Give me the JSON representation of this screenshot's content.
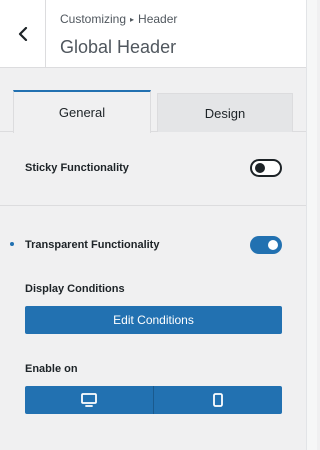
{
  "header": {
    "breadcrumb_parent": "Customizing",
    "breadcrumb_separator": "▸",
    "breadcrumb_current": "Header",
    "title": "Global Header"
  },
  "tabs": [
    {
      "label": "General",
      "active": true
    },
    {
      "label": "Design",
      "active": false
    }
  ],
  "settings": {
    "sticky": {
      "label": "Sticky Functionality",
      "enabled": false
    },
    "transparent": {
      "label": "Transparent Functionality",
      "enabled": true
    },
    "display_conditions": {
      "label": "Display Conditions",
      "button_label": "Edit Conditions"
    },
    "enable_on": {
      "label": "Enable on",
      "devices": [
        {
          "icon": "desktop-icon"
        },
        {
          "icon": "mobile-icon"
        }
      ]
    }
  },
  "colors": {
    "accent": "#2271b1",
    "panel_bg": "#f0f0f1",
    "header_bg": "#ffffff",
    "text": "#1d2327"
  }
}
